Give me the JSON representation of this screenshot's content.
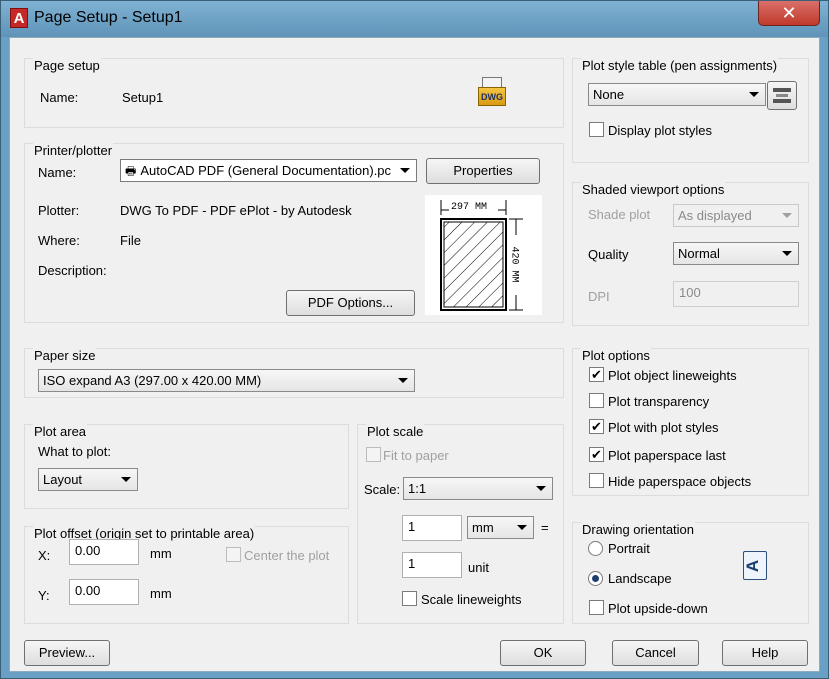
{
  "window": {
    "title": "Page Setup - Setup1",
    "app_icon": "A",
    "close_glyph": "✕"
  },
  "page_setup": {
    "title": "Page setup",
    "name_label": "Name:",
    "name_value": "Setup1",
    "dwg_icon_text": "DWG"
  },
  "printer": {
    "title": "Printer/plotter",
    "name_label": "Name:",
    "printer_value": "AutoCAD PDF (General Documentation).pc",
    "properties_button": "Properties",
    "plotter_label": "Plotter:",
    "plotter_value": "DWG To PDF - PDF ePlot - by Autodesk",
    "where_label": "Where:",
    "where_value": "File",
    "description_label": "Description:",
    "pdf_options_button": "PDF Options...",
    "preview_width": "297 MM",
    "preview_height": "420 MM"
  },
  "paper_size": {
    "title": "Paper size",
    "value": "ISO expand A3 (297.00 x 420.00 MM)"
  },
  "plot_area": {
    "title": "Plot area",
    "what_label": "What to plot:",
    "what_value": "Layout"
  },
  "plot_offset": {
    "title": "Plot offset (origin set to printable area)",
    "x_label": "X:",
    "x_value": "0.00",
    "x_unit": "mm",
    "y_label": "Y:",
    "y_value": "0.00",
    "y_unit": "mm",
    "center_label": "Center the plot"
  },
  "plot_scale": {
    "title": "Plot scale",
    "fit_label": "Fit to paper",
    "scale_label": "Scale:",
    "scale_value": "1:1",
    "value1": "1",
    "unit1": "mm",
    "equals": "=",
    "value2": "1",
    "unit2": "unit",
    "lineweights_label": "Scale lineweights"
  },
  "plot_style": {
    "title": "Plot style table (pen assignments)",
    "value": "None",
    "display_label": "Display plot styles"
  },
  "shaded": {
    "title": "Shaded viewport options",
    "shade_label": "Shade plot",
    "shade_value": "As displayed",
    "quality_label": "Quality",
    "quality_value": "Normal",
    "dpi_label": "DPI",
    "dpi_value": "100"
  },
  "plot_options": {
    "title": "Plot options",
    "items": [
      {
        "label": "Plot object lineweights",
        "checked": true
      },
      {
        "label": "Plot transparency",
        "checked": false
      },
      {
        "label": "Plot with plot styles",
        "checked": true
      },
      {
        "label": "Plot paperspace last",
        "checked": true
      },
      {
        "label": "Hide paperspace objects",
        "checked": false
      }
    ]
  },
  "orientation": {
    "title": "Drawing orientation",
    "portrait": "Portrait",
    "landscape": "Landscape",
    "upside_down": "Plot upside-down",
    "selected": "Landscape",
    "icon_letter": "A"
  },
  "footer": {
    "preview": "Preview...",
    "ok": "OK",
    "cancel": "Cancel",
    "help": "Help"
  }
}
